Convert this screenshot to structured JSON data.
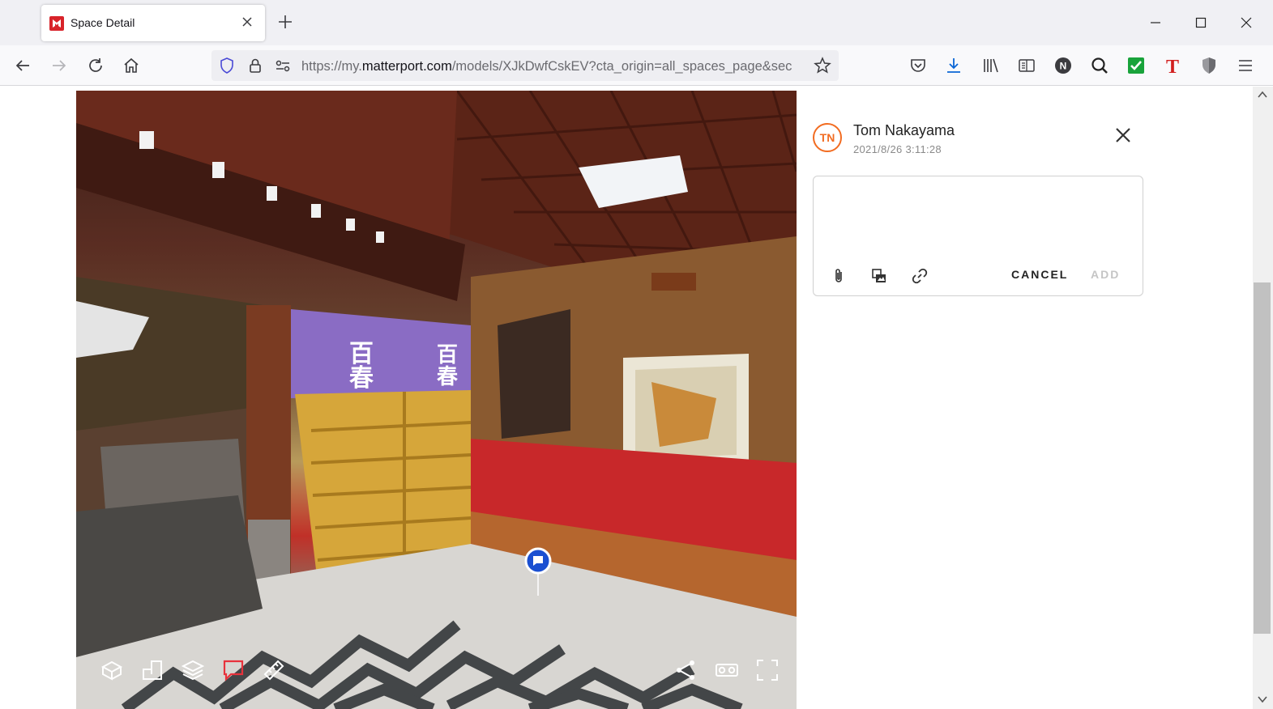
{
  "browser": {
    "tab": {
      "title": "Space Detail",
      "favicon": "matterport-logo-icon"
    },
    "url": {
      "prefix": "https://my.",
      "domain": "matterport.com",
      "path": "/models/XJkDwfCskEV?cta_origin=all_spaces_page&sec"
    },
    "icons": [
      "back-icon",
      "forward-icon",
      "reload-icon",
      "home-icon",
      "shield-icon",
      "lock-icon",
      "permissions-icon",
      "bookmark-star-icon",
      "pocket-icon",
      "download-icon",
      "library-icon",
      "reader-icon",
      "extension-n-icon",
      "extension-search-icon",
      "extension-check-icon",
      "extension-t-icon",
      "extension-shield-icon",
      "menu-icon"
    ]
  },
  "comment_panel": {
    "author_initials": "TN",
    "author_name": "Tom Nakayama",
    "timestamp": "2021/8/26 3:11:28",
    "input_value": "",
    "cancel_label": "CANCEL",
    "add_label": "ADD"
  },
  "colors": {
    "accent_orange": "#f26c21",
    "tag_blue": "#1a4fd1",
    "active_tool_red": "#e8323c",
    "matterport_red": "#d8232a"
  }
}
